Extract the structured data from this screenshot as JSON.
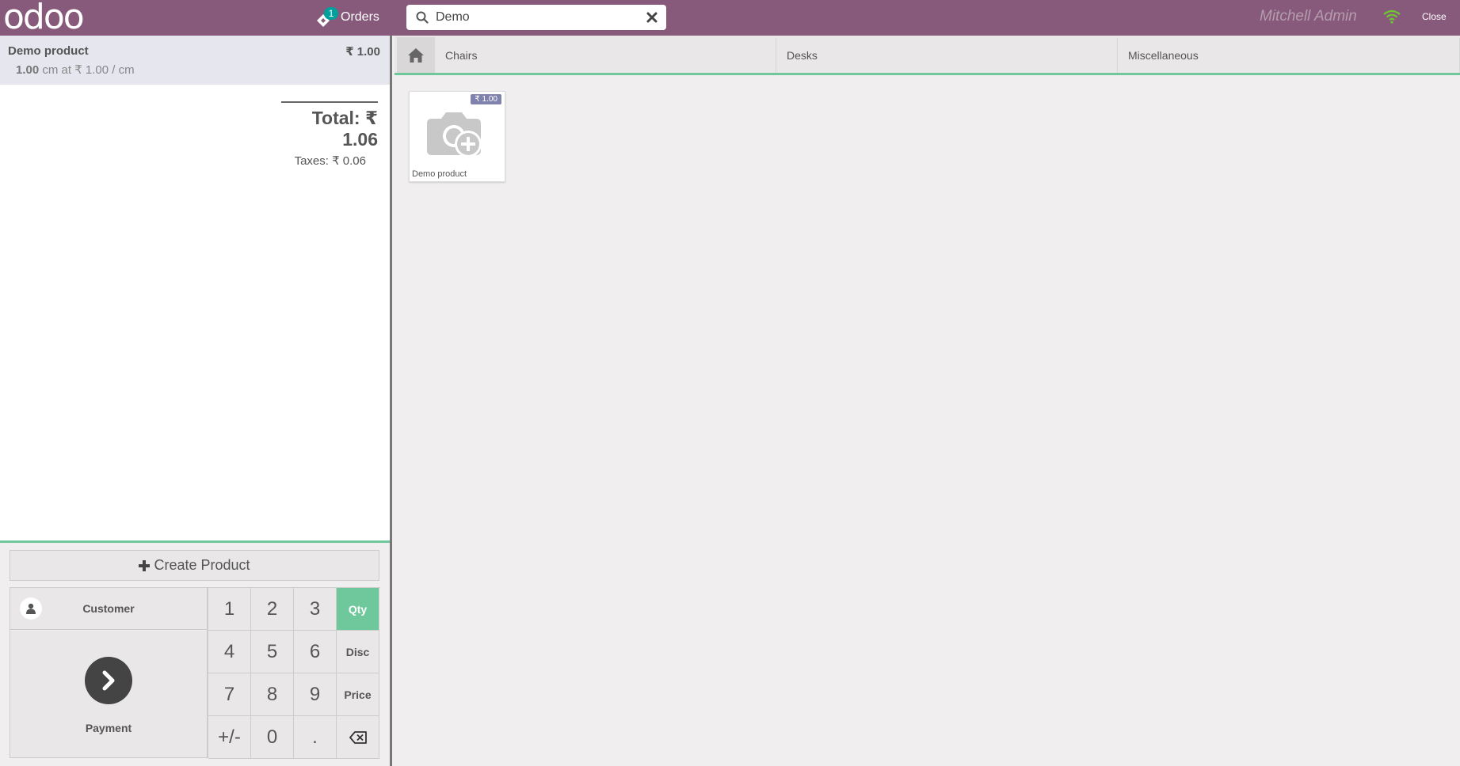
{
  "topbar": {
    "logo_text": "odoo",
    "orders_label": "Orders",
    "orders_count": "1",
    "search_value": "Demo",
    "user_name": "Mitchell Admin",
    "close_label": "Close"
  },
  "order": {
    "lines": [
      {
        "name": "Demo product",
        "price": "₹ 1.00",
        "qty": "1.00",
        "unit_detail": "cm at ₹ 1.00 / cm"
      }
    ],
    "total": "Total: ₹ 1.06",
    "taxes": "Taxes: ₹ 0.06"
  },
  "controls": {
    "create_product": "Create Product",
    "customer": "Customer",
    "payment": "Payment"
  },
  "numpad": [
    "1",
    "2",
    "3",
    "Qty",
    "4",
    "5",
    "6",
    "Disc",
    "7",
    "8",
    "9",
    "Price",
    "+/-",
    "0",
    "."
  ],
  "active_mode": "Qty",
  "categories": [
    "Chairs",
    "Desks",
    "Miscellaneous"
  ],
  "products": [
    {
      "name": "Demo product",
      "price": "₹ 1.00"
    }
  ],
  "colors": {
    "brand": "#875a7b",
    "accent": "#6ec89b",
    "badge": "#00a09d",
    "price_tag": "#7f82ac"
  }
}
